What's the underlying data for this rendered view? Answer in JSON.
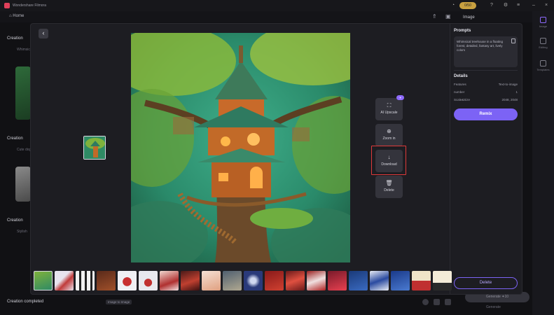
{
  "app": {
    "title": "Wondershare Filmora",
    "home_label": "Home",
    "credits": "0/50"
  },
  "background": {
    "sections": [
      {
        "title": "Creation",
        "subtitle": "Whimsical treehouse"
      },
      {
        "title": "Creation",
        "subtitle": "Cute dog"
      },
      {
        "title": "Creation",
        "subtitle": "Stylish"
      }
    ],
    "bottom_title": "Creation completed",
    "bottom_tag": "Image to Image",
    "image_tab": "Image",
    "generate_label": "Generate",
    "generate_count": "10",
    "generate_sub": "Generate"
  },
  "rightbar": {
    "items": [
      {
        "label": "Image",
        "icon": "image-icon"
      },
      {
        "label": "Editing",
        "icon": "edit-icon"
      },
      {
        "label": "Templates",
        "icon": "templates-icon"
      }
    ]
  },
  "viewer": {
    "back_icon": "back-arrow-icon",
    "actions": [
      {
        "label": "AI Upscale",
        "icon": "upscale-icon",
        "badge": "✦"
      },
      {
        "label": "Zoom in",
        "icon": "zoom-in-icon"
      },
      {
        "label": "Download",
        "icon": "download-icon"
      },
      {
        "label": "Delete",
        "icon": "trash-icon"
      }
    ],
    "highlight_color": "#e03a3a"
  },
  "panel": {
    "prompts_title": "Prompts",
    "prompt_text": "Whimsical treehouse in a floating forest, detailed, fantasy art, lively colors",
    "details_title": "Details",
    "details": [
      {
        "key": "Features",
        "value": "Text-to-image"
      },
      {
        "key": "number",
        "value": "1"
      },
      {
        "key": "Scale&Size",
        "value": "2048, 2048"
      }
    ],
    "remix_label": "Remix",
    "delete_label": "Delete",
    "accent": "#7c63f5"
  },
  "thumbnails": [
    "treehouse",
    "christmas-1",
    "christmas-2",
    "christmas-3",
    "santa-1",
    "santa-2",
    "santa-3",
    "santa-4",
    "santa-5",
    "scene-1",
    "scene-2",
    "scene-3",
    "scene-4",
    "scene-5",
    "scene-6",
    "scene-7",
    "scene-8",
    "scene-9",
    "scene-10",
    "scene-11"
  ]
}
